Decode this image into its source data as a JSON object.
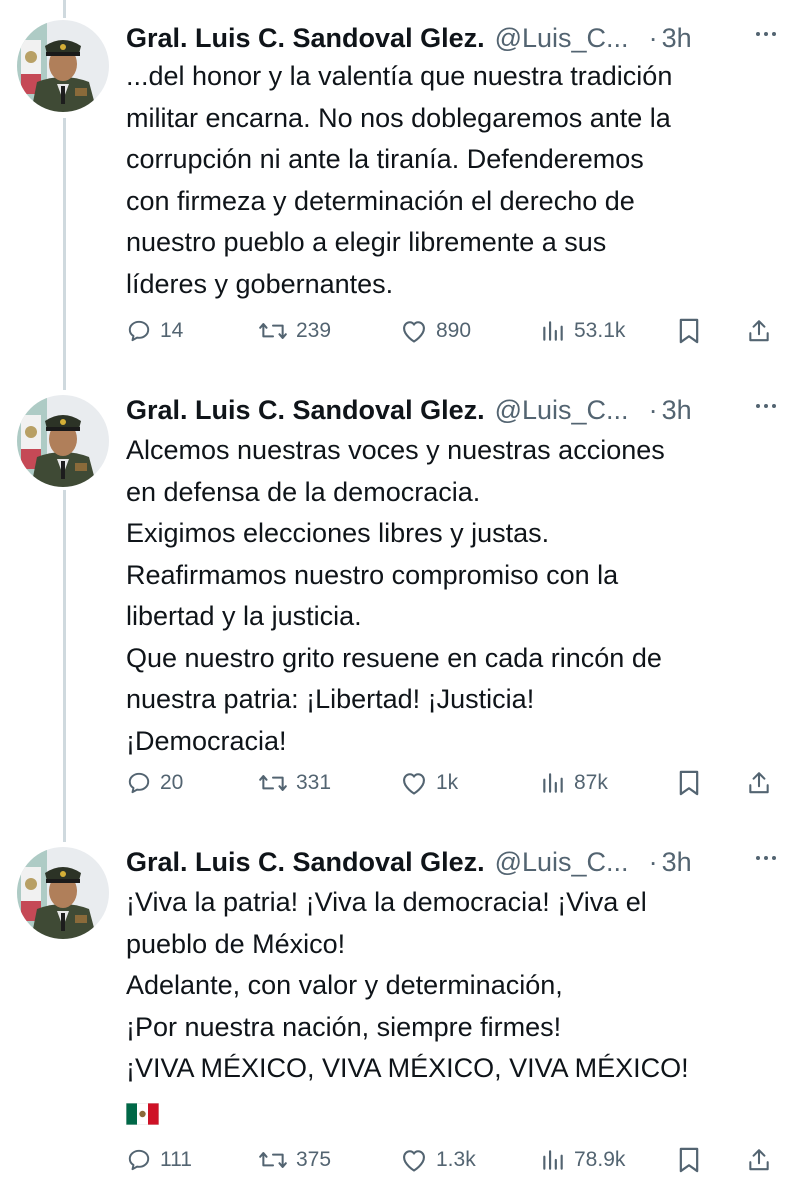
{
  "tweets": [
    {
      "author_name": "Gral. Luis C. Sandoval Glez.",
      "handle": "@Luis_C...",
      "separator": "·",
      "time": "3h",
      "lines": [
        "...del honor y la valentía que nuestra tradición",
        "militar encarna. No nos doblegaremos ante la",
        "corrupción ni ante la tiranía. Defenderemos",
        "con firmeza y determinación el derecho de",
        "nuestro pueblo a elegir libremente a sus",
        "líderes y gobernantes."
      ],
      "replies": "14",
      "reposts": "239",
      "likes": "890",
      "views": "53.1k"
    },
    {
      "author_name": "Gral. Luis C. Sandoval Glez.",
      "handle": "@Luis_C...",
      "separator": "·",
      "time": "3h",
      "lines": [
        "Alcemos nuestras voces y nuestras acciones",
        "en defensa de la democracia.",
        "Exigimos elecciones libres y justas.",
        "Reafirmamos nuestro compromiso con la",
        "libertad y la justicia.",
        "Que nuestro grito resuene en cada rincón de",
        "nuestra patria: ¡Libertad! ¡Justicia!",
        "¡Democracia!"
      ],
      "replies": "20",
      "reposts": "331",
      "likes": "1k",
      "views": "87k"
    },
    {
      "author_name": "Gral. Luis C. Sandoval Glez.",
      "handle": "@Luis_C...",
      "separator": "·",
      "time": "3h",
      "lines": [
        "¡Viva la patria! ¡Viva la democracia! ¡Viva el",
        "pueblo de México!",
        "Adelante, con valor y determinación,",
        "¡Por nuestra nación, siempre firmes!",
        "¡VIVA MÉXICO, VIVA MÉXICO, VIVA MÉXICO!"
      ],
      "emoji": "mexico-flag-emoji",
      "replies": "111",
      "reposts": "375",
      "likes": "1.3k",
      "views": "78.9k"
    }
  ],
  "colors": {
    "text": "#0f1419",
    "secondary": "#536471",
    "thread_line": "#cfd9de",
    "flag_green": "#006847",
    "flag_red": "#ce1126"
  }
}
